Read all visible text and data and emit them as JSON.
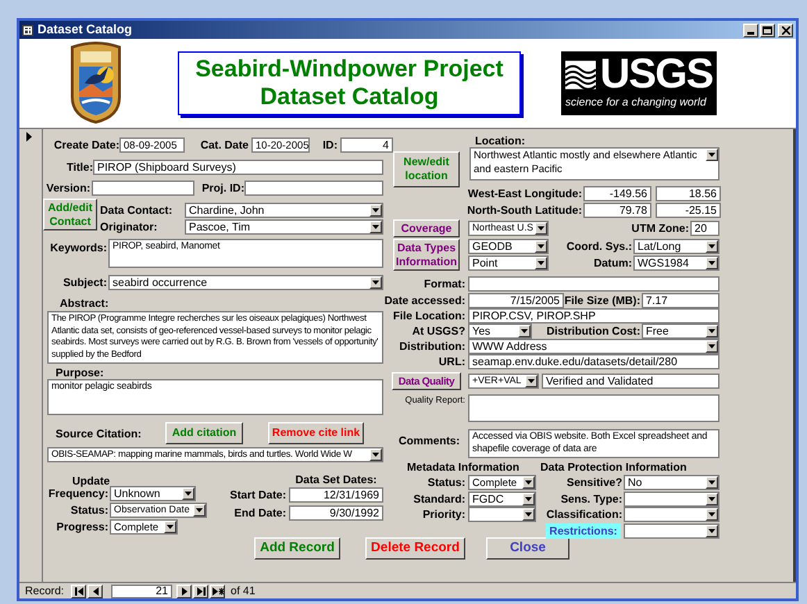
{
  "window": {
    "title": "Dataset Catalog"
  },
  "header": {
    "project_title": "Seabird-Windpower Project",
    "catalog_title": "Dataset Catalog",
    "usgs_logo": {
      "wordmark": "USGS",
      "tagline": "science for a changing world"
    }
  },
  "form": {
    "create_date": {
      "label": "Create Date:",
      "value": "08-09-2005"
    },
    "cat_date": {
      "label": "Cat. Date",
      "value": "10-20-2005"
    },
    "id": {
      "label": "ID:",
      "value": "4"
    },
    "title": {
      "label": "Title:",
      "value": "PIROP (Shipboard Surveys)"
    },
    "version": {
      "label": "Version:"
    },
    "proj_id": {
      "label": "Proj. ID:"
    },
    "add_edit_contact_button": "Add/edit Contact",
    "data_contact": {
      "label": "Data Contact:",
      "value": "Chardine, John"
    },
    "originator": {
      "label": "Originator:",
      "value": "Pascoe, Tim"
    },
    "keywords": {
      "label": "Keywords:",
      "value": "PIROP, seabird, Manomet"
    },
    "subject": {
      "label": "Subject:",
      "value": "seabird occurrence"
    },
    "abstract": {
      "label": "Abstract:",
      "value": "The PIROP (Programme Integre recherches sur les oiseaux pelagiques) Northwest Atlantic data set, consists of geo-referenced vessel-based surveys to monitor pelagic seabirds. Most surveys were carried out by R.G. B. Brown from 'vessels of opportunity' supplied by the Bedford"
    },
    "purpose": {
      "label": "Purpose:",
      "value": "monitor pelagic seabirds"
    },
    "source_citation": {
      "label": "Source Citation:",
      "value": "OBIS-SEAMAP: mapping marine mammals, birds and turtles. World Wide W"
    },
    "add_citation_button": "Add citation",
    "remove_cite_link_button": "Remove cite link",
    "update": {
      "heading": "Update",
      "frequency": {
        "label": "Frequency:",
        "value": "Unknown"
      },
      "status": {
        "label": "Status:",
        "value": "Observation Date"
      },
      "progress": {
        "label": "Progress:",
        "value": "Complete"
      }
    },
    "data_set_dates": {
      "heading": "Data Set Dates:",
      "start_date": {
        "label": "Start Date:",
        "value": "12/31/1969"
      },
      "end_date": {
        "label": "End Date:",
        "value": "9/30/1992"
      }
    },
    "location": {
      "label": "Location:",
      "value": "Northwest Atlantic mostly and elsewhere Atlantic and eastern Pacific"
    },
    "new_edit_location_button": "New/edit location",
    "west_east_longitude": {
      "label": "West-East Longitude:",
      "values": [
        "-149.56",
        "18.56"
      ]
    },
    "north_south_latitude": {
      "label": "North-South Latitude:",
      "values": [
        "79.78",
        "-25.15"
      ]
    },
    "coverage_button": "Coverage",
    "coverage": {
      "value": "Northeast U.S"
    },
    "utm_zone": {
      "label": "UTM Zone:",
      "value": "20"
    },
    "data_types_information_button": "Data Types Information",
    "data_types": [
      "GEODB",
      "Point"
    ],
    "coord_sys": {
      "label": "Coord. Sys.:",
      "value": "Lat/Long"
    },
    "datum": {
      "label": "Datum:",
      "value": "WGS1984"
    },
    "format": {
      "label": "Format:"
    },
    "date_accessed": {
      "label": "Date accessed:",
      "value": "7/15/2005"
    },
    "file_size": {
      "label": "File Size (MB):",
      "value": "7.17"
    },
    "file_location": {
      "label": "File Location:",
      "value": "PIROP.CSV, PIROP.SHP"
    },
    "at_usgs": {
      "label": "At USGS?",
      "value": "Yes"
    },
    "distribution_cost": {
      "label": "Distribution Cost:",
      "value": "Free"
    },
    "distribution": {
      "label": "Distribution:",
      "value": "WWW Address"
    },
    "url": {
      "label": "URL:",
      "value": "seamap.env.duke.edu/datasets/detail/280"
    },
    "data_quality_button": "Data Quality",
    "data_quality": {
      "code": "+VER+VAL",
      "description": "Verified and Validated"
    },
    "quality_report": {
      "label": "Quality Report:"
    },
    "comments": {
      "label": "Comments:",
      "value": "Accessed via OBIS website. Both Excel spreadsheet and shapefile coverage of data are"
    },
    "metadata_information": {
      "heading": "Metadata Information",
      "status": {
        "label": "Status:",
        "value": "Complete"
      },
      "standard": {
        "label": "Standard:",
        "value": "FGDC"
      },
      "priority": {
        "label": "Priority:"
      }
    },
    "data_protection_information": {
      "heading": "Data Protection Information",
      "sensitive": {
        "label": "Sensitive?",
        "value": "No"
      },
      "sens_type": {
        "label": "Sens. Type:"
      },
      "classification": {
        "label": "Classification:"
      },
      "restrictions": {
        "label": "Restrictions:"
      }
    },
    "add_record_button": "Add Record",
    "delete_record_button": "Delete Record",
    "close_button": "Close"
  },
  "record_navigator": {
    "label": "Record:",
    "current": "21",
    "total": "of 41"
  }
}
